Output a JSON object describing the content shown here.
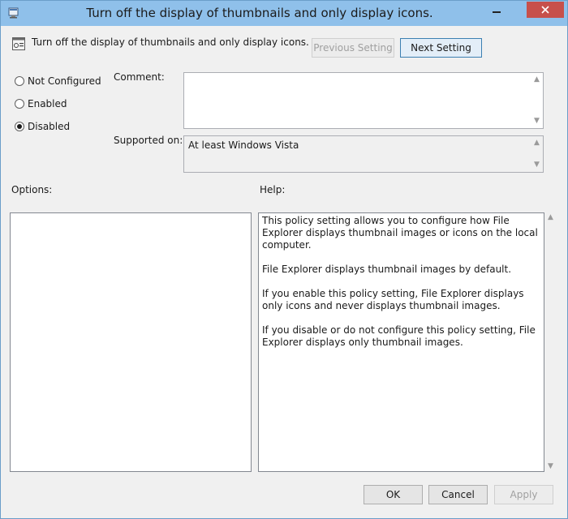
{
  "window": {
    "title": "Turn off the display of thumbnails and only display icons."
  },
  "header": {
    "policy_name": "Turn off the display of thumbnails and only display icons.",
    "previous_label": "Previous Setting",
    "next_label": "Next Setting"
  },
  "state": {
    "options": [
      {
        "label": "Not Configured",
        "selected": false
      },
      {
        "label": "Enabled",
        "selected": false
      },
      {
        "label": "Disabled",
        "selected": true
      }
    ]
  },
  "fields": {
    "comment_label": "Comment:",
    "comment_value": "",
    "supported_label": "Supported on:",
    "supported_value": "At least Windows Vista"
  },
  "sections": {
    "options_label": "Options:",
    "help_label": "Help:"
  },
  "help": {
    "paragraphs": [
      "This policy setting allows you to configure how File Explorer displays thumbnail images or icons on the local computer.",
      "File Explorer displays thumbnail images by default.",
      "If you enable this policy setting, File Explorer displays only icons and never displays thumbnail images.",
      "If you disable or do not configure this policy setting, File Explorer displays only thumbnail images."
    ]
  },
  "footer": {
    "ok_label": "OK",
    "cancel_label": "Cancel",
    "apply_label": "Apply"
  },
  "colors": {
    "titlebar": "#8fc0ea",
    "close_button": "#c7504b"
  }
}
